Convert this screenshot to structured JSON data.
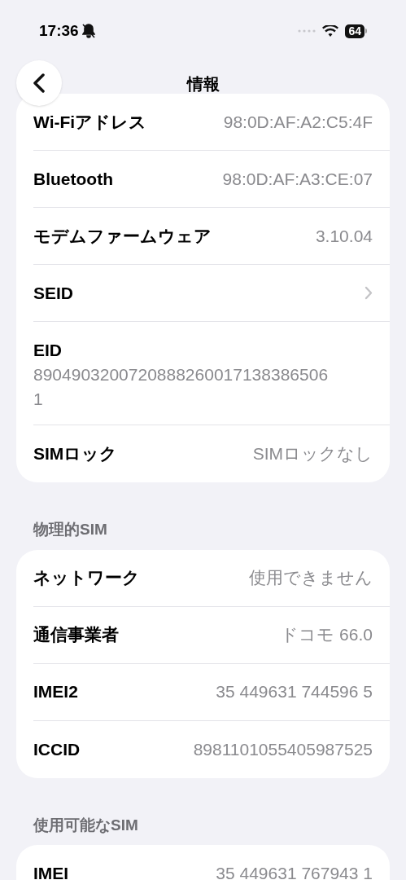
{
  "status_bar": {
    "time": "17:36",
    "battery": "64"
  },
  "nav": {
    "title": "情報"
  },
  "sections": [
    {
      "rows": [
        {
          "kind": "value",
          "label": "Wi-Fiアドレス",
          "value": "98:0D:AF:A2:C5:4F"
        },
        {
          "kind": "value",
          "label": "Bluetooth",
          "value": "98:0D:AF:A3:CE:07"
        },
        {
          "kind": "value",
          "label": "モデムファームウェア",
          "value": "3.10.04"
        },
        {
          "kind": "link",
          "label": "SEID"
        },
        {
          "kind": "stacked",
          "label": "EID",
          "value": "89049032007208882600171383865061"
        },
        {
          "kind": "value",
          "label": "SIMロック",
          "value": "SIMロックなし"
        }
      ]
    },
    {
      "header": "物理的SIM",
      "rows": [
        {
          "kind": "value",
          "label": "ネットワーク",
          "value": "使用できません"
        },
        {
          "kind": "value",
          "label": "通信事業者",
          "value": "ドコモ 66.0"
        },
        {
          "kind": "value",
          "label": "IMEI2",
          "value": "35 449631 744596 5"
        },
        {
          "kind": "value",
          "label": "ICCID",
          "value": "8981101055405987525"
        }
      ]
    },
    {
      "header": "使用可能なSIM",
      "rows": [
        {
          "kind": "value",
          "label": "IMEI",
          "value": "35 449631 767943 1"
        }
      ]
    }
  ]
}
